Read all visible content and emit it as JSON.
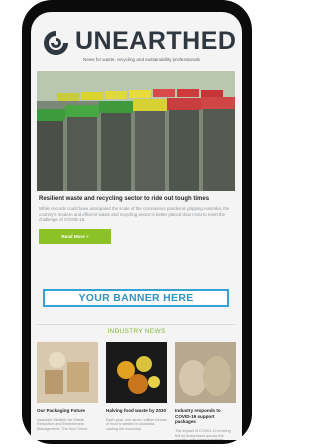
{
  "brand": {
    "name": "UNEARTHED",
    "tagline": "News for waste, recycling and sustainability professionals"
  },
  "feature": {
    "headline": "Resilient waste and recycling sector to ride out tough times",
    "summary": "While records could have anticipated the scale of the coronavirus pandemic gripping Australia, the country's modern and efficient waste and recycling sector is better placed than most to meet the challenge of COVID-19.",
    "cta_label": "Read More »"
  },
  "banner": {
    "text": "YOUR BANNER HERE"
  },
  "industry_news": {
    "title": "INDUSTRY NEWS",
    "items": [
      {
        "title": "Our Packaging Future",
        "summary": "Assistant Minister for Waste Reduction and Environment Management, The Hon Trevor"
      },
      {
        "title": "Halving food waste by 2030",
        "summary": "Each year, one seven million tonnes of food is wasted in Australia, costing the economy"
      },
      {
        "title": "Industry responds to COVID-19 support packages",
        "summary": "The impact of COVID-19 is being felt by businesses across the country, with some industries"
      }
    ]
  },
  "colors": {
    "accent_green": "#8cc226",
    "banner_blue": "#36a1d4",
    "brand_dark": "#2f3740"
  }
}
